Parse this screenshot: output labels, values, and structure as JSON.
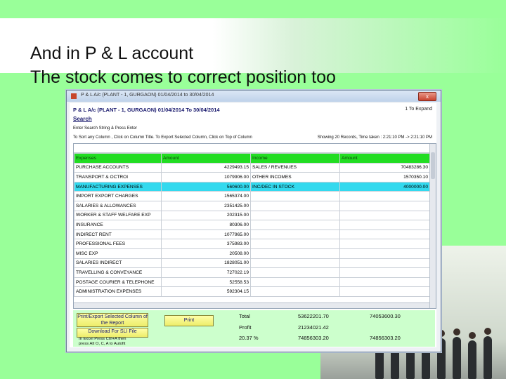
{
  "slide": {
    "line1": "And in P & L account",
    "line2": "The stock comes to correct position too"
  },
  "window": {
    "title": "P & L A/c (PLANT - 1, GURGAON) 01/04/2014 to 30/04/2014",
    "close": "x",
    "header_title": "P & L A/c (PLANT - 1, GURGAON) 01/04/2014 To 30/04/2014",
    "expand": "1 To Expand",
    "search_link": "Search",
    "search_instruction": "Enter Search String & Press Enter",
    "sort_instruction": "To Sort any Column , Click on Column Title. To Export Selected Column, Click on Top of Column",
    "showing": "Showing 20 Records, Time taken : 2:21:10 PM -> 2:21:10 PM"
  },
  "grid": {
    "headers": [
      "Expenses",
      "Amount",
      "Income",
      "Amount"
    ],
    "rows": [
      [
        "PURCHASE ACCOUNTS",
        "4229493.15",
        "SALES / REVENUES",
        "70483286.30"
      ],
      [
        "TRANSPORT & OCTROI",
        "1079906.00",
        "OTHER INCOMES",
        "1570350.10"
      ],
      [
        "MANUFACTURING EXPENSES",
        "560600.00",
        "INC/DEC IN STOCK",
        "4000000.00"
      ],
      [
        "IMPORT EXPORT CHARGES",
        "1565374.00",
        "",
        ""
      ],
      [
        "SALARIES & ALLOWANCES",
        "2351425.00",
        "",
        ""
      ],
      [
        "WORKER & STAFF WELFARE EXP",
        "202315.00",
        "",
        ""
      ],
      [
        "INSURANCE",
        "80306.00",
        "",
        ""
      ],
      [
        "INDIRECT RENT",
        "1077965.00",
        "",
        ""
      ],
      [
        "PROFESSIONAL FEES",
        "375983.00",
        "",
        ""
      ],
      [
        "MISC EXP",
        "20508.00",
        "",
        ""
      ],
      [
        "SALARIES INDIRECT",
        "1828051.00",
        "",
        ""
      ],
      [
        "TRAVELLING & CONVEYANCE",
        "727022.19",
        "",
        ""
      ],
      [
        "POSTAGE COURIER & TELEPHONE",
        "52558.53",
        "",
        ""
      ],
      [
        "ADMINISTRATION EXPENSES",
        "592304.15",
        "",
        ""
      ]
    ],
    "selected_row": 2
  },
  "footer": {
    "print_export_btn": "Print/Export Selected Column of the Report",
    "download_btn": "Download For SLI File",
    "excel_note_1": "In Excel Press Ctrl+A then",
    "excel_note_2": "press Alt O, C, A to Autofit",
    "print_btn": "Print",
    "total_label": "Total",
    "total_expense": "53622201.70",
    "total_income": "74053600.30",
    "profit_label": "Profit",
    "profit_value": "21234021.42",
    "percent_label": "20.37 %",
    "percent_expense": "74856303.20",
    "percent_income": "74856303.20"
  },
  "colors": {
    "slide_bg": "#99ff99",
    "grid_header": "#22dd22",
    "selected_row": "#33d9ee",
    "footer_bg": "#ccffcc",
    "button_bg": "#eded6a"
  }
}
